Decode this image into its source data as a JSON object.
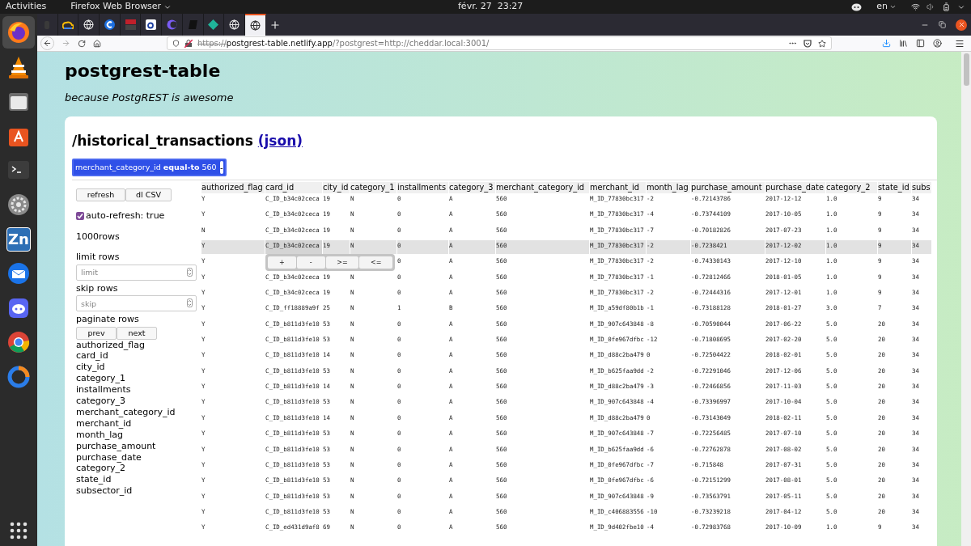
{
  "topbar": {
    "activities": "Activities",
    "app_menu": "Firefox Web Browser",
    "clock": "févr. 27  23:27",
    "language": "en"
  },
  "dock": [
    {
      "kind": "firefox",
      "selected": true
    },
    {
      "kind": "cone",
      "selected": false
    },
    {
      "kind": "folder",
      "selected": false
    },
    {
      "kind": "bag",
      "selected": false
    },
    {
      "kind": "terminal",
      "selected": false
    },
    {
      "kind": "gear",
      "selected": false
    },
    {
      "kind": "zn",
      "label": "Zn",
      "selected": false
    },
    {
      "kind": "mail",
      "selected": false
    },
    {
      "kind": "chat",
      "selected": false
    },
    {
      "kind": "chrome",
      "selected": false
    },
    {
      "kind": "ring",
      "selected": false
    }
  ],
  "browser_tabs": [
    {
      "kind": "dark",
      "selected": false
    },
    {
      "kind": "cloud",
      "selected": false
    },
    {
      "kind": "globe",
      "selected": false
    },
    {
      "kind": "c",
      "selected": false
    },
    {
      "kind": "red",
      "selected": false
    },
    {
      "kind": "square",
      "selected": false
    },
    {
      "kind": "moon",
      "selected": false
    },
    {
      "kind": "note",
      "selected": false
    },
    {
      "kind": "diamond",
      "selected": false
    },
    {
      "kind": "globe",
      "selected": false
    },
    {
      "kind": "globe",
      "selected": true
    }
  ],
  "url": {
    "scheme": "https://",
    "host": "postgrest-table.netlify.app",
    "rest": "/?postgrest=http://cheddar.local:3001/"
  },
  "page": {
    "title": "postgrest-table",
    "subtitle": "because PostgREST is awesome",
    "heading": "/historical_transactions",
    "json_link": "(json)"
  },
  "filter": {
    "column": "merchant_category_id",
    "operator": "equal-to",
    "value": "560",
    "remove": "-"
  },
  "sidebar": {
    "refresh": "refresh",
    "download": "dl CSV",
    "auto_refresh": {
      "label": "auto-refresh: true",
      "checked": true
    },
    "row_count": "1000rows",
    "limit": {
      "label": "limit rows",
      "placeholder": "limit"
    },
    "skip": {
      "label": "skip rows",
      "placeholder": "skip"
    },
    "paginate": {
      "label": "paginate rows",
      "prev": "prev",
      "next": "next"
    },
    "columns": [
      "authorized_flag",
      "card_id",
      "city_id",
      "category_1",
      "installments",
      "category_3",
      "merchant_category_id",
      "merchant_id",
      "month_lag",
      "purchase_amount",
      "purchase_date",
      "category_2",
      "state_id",
      "subsector_id"
    ]
  },
  "table": {
    "columns": [
      "authorized_flag",
      "card_id",
      "city_id",
      "category_1",
      "installments",
      "category_3",
      "merchant_category_id",
      "merchant_id",
      "month_lag",
      "purchase_amount",
      "purchase_date",
      "category_2",
      "state_id",
      "subs"
    ],
    "cell_menu": [
      "+",
      "-",
      ">=",
      "<="
    ],
    "rows": [
      {
        "selected": false,
        "cells": [
          "Y",
          "C_ID_b34c02ceca",
          "19",
          "N",
          "0",
          "A",
          "560",
          "M_ID_77830bc317",
          "-2",
          "-0.72143786",
          "2017-12-12",
          "1.0",
          "9",
          "34"
        ]
      },
      {
        "selected": false,
        "cells": [
          "Y",
          "C_ID_b34c02ceca",
          "19",
          "N",
          "0",
          "A",
          "560",
          "M_ID_77830bc317",
          "-4",
          "-0.73744109",
          "2017-10-05",
          "1.0",
          "9",
          "34"
        ]
      },
      {
        "selected": false,
        "cells": [
          "N",
          "C_ID_b34c02ceca",
          "19",
          "N",
          "0",
          "A",
          "560",
          "M_ID_77830bc317",
          "-7",
          "-0.70182826",
          "2017-07-23",
          "1.0",
          "9",
          "34"
        ]
      },
      {
        "selected": true,
        "cells": [
          "Y",
          "C_ID_b34c02ceca",
          "19",
          "N",
          "0",
          "A",
          "560",
          "M_ID_77830bc317",
          "-2",
          "-0.7238421",
          "2017-12-02",
          "1.0",
          "9",
          "34"
        ]
      },
      {
        "selected": false,
        "cells": [
          "Y",
          null,
          null,
          null,
          "0",
          "A",
          "560",
          "M_ID_77830bc317",
          "-2",
          "-0.74330143",
          "2017-12-10",
          "1.0",
          "9",
          "34"
        ]
      },
      {
        "selected": false,
        "cells": [
          "Y",
          "C_ID_b34c02ceca",
          "19",
          "N",
          "0",
          "A",
          "560",
          "M_ID_77830bc317",
          "-1",
          "-0.72812466",
          "2018-01-05",
          "1.0",
          "9",
          "34"
        ]
      },
      {
        "selected": false,
        "cells": [
          "Y",
          "C_ID_b34c02ceca",
          "19",
          "N",
          "0",
          "A",
          "560",
          "M_ID_77830bc317",
          "-2",
          "-0.72444316",
          "2017-12-01",
          "1.0",
          "9",
          "34"
        ]
      },
      {
        "selected": false,
        "cells": [
          "Y",
          "C_ID_ff18889a9f",
          "25",
          "N",
          "1",
          "B",
          "560",
          "M_ID_a59df80b1b",
          "-1",
          "-0.73188128",
          "2018-01-27",
          "3.0",
          "7",
          "34"
        ]
      },
      {
        "selected": false,
        "cells": [
          "Y",
          "C_ID_b811d3fe10",
          "53",
          "N",
          "0",
          "A",
          "560",
          "M_ID_907c643848",
          "-8",
          "-0.70590044",
          "2017-06-22",
          "5.0",
          "20",
          "34"
        ]
      },
      {
        "selected": false,
        "cells": [
          "Y",
          "C_ID_b811d3fe10",
          "53",
          "N",
          "0",
          "A",
          "560",
          "M_ID_0fe967dfbc",
          "-12",
          "-0.71808695",
          "2017-02-20",
          "5.0",
          "20",
          "34"
        ]
      },
      {
        "selected": false,
        "cells": [
          "Y",
          "C_ID_b811d3fe10",
          "14",
          "N",
          "0",
          "A",
          "560",
          "M_ID_d88c2ba479",
          "0",
          "-0.72504422",
          "2018-02-01",
          "5.0",
          "20",
          "34"
        ]
      },
      {
        "selected": false,
        "cells": [
          "Y",
          "C_ID_b811d3fe10",
          "53",
          "N",
          "0",
          "A",
          "560",
          "M_ID_b625faa9dd",
          "-2",
          "-0.72291046",
          "2017-12-06",
          "5.0",
          "20",
          "34"
        ]
      },
      {
        "selected": false,
        "cells": [
          "Y",
          "C_ID_b811d3fe10",
          "14",
          "N",
          "0",
          "A",
          "560",
          "M_ID_d88c2ba479",
          "-3",
          "-0.72466856",
          "2017-11-03",
          "5.0",
          "20",
          "34"
        ]
      },
      {
        "selected": false,
        "cells": [
          "Y",
          "C_ID_b811d3fe10",
          "53",
          "N",
          "0",
          "A",
          "560",
          "M_ID_907c643848",
          "-4",
          "-0.73396997",
          "2017-10-04",
          "5.0",
          "20",
          "34"
        ]
      },
      {
        "selected": false,
        "cells": [
          "Y",
          "C_ID_b811d3fe10",
          "14",
          "N",
          "0",
          "A",
          "560",
          "M_ID_d88c2ba479",
          "0",
          "-0.73143049",
          "2018-02-11",
          "5.0",
          "20",
          "34"
        ]
      },
      {
        "selected": false,
        "cells": [
          "Y",
          "C_ID_b811d3fe10",
          "53",
          "N",
          "0",
          "A",
          "560",
          "M_ID_907c643848",
          "-7",
          "-0.72256485",
          "2017-07-10",
          "5.0",
          "20",
          "34"
        ]
      },
      {
        "selected": false,
        "cells": [
          "Y",
          "C_ID_b811d3fe10",
          "53",
          "N",
          "0",
          "A",
          "560",
          "M_ID_b625faa9dd",
          "-6",
          "-0.72762878",
          "2017-08-02",
          "5.0",
          "20",
          "34"
        ]
      },
      {
        "selected": false,
        "cells": [
          "Y",
          "C_ID_b811d3fe10",
          "53",
          "N",
          "0",
          "A",
          "560",
          "M_ID_0fe967dfbc",
          "-7",
          "-0.715848",
          "2017-07-31",
          "5.0",
          "20",
          "34"
        ]
      },
      {
        "selected": false,
        "cells": [
          "Y",
          "C_ID_b811d3fe10",
          "53",
          "N",
          "0",
          "A",
          "560",
          "M_ID_0fe967dfbc",
          "-6",
          "-0.72151299",
          "2017-08-01",
          "5.0",
          "20",
          "34"
        ]
      },
      {
        "selected": false,
        "cells": [
          "Y",
          "C_ID_b811d3fe10",
          "53",
          "N",
          "0",
          "A",
          "560",
          "M_ID_907c643848",
          "-9",
          "-0.73563791",
          "2017-05-11",
          "5.0",
          "20",
          "34"
        ]
      },
      {
        "selected": false,
        "cells": [
          "Y",
          "C_ID_b811d3fe10",
          "53",
          "N",
          "0",
          "A",
          "560",
          "M_ID_c406883556",
          "-10",
          "-0.73239218",
          "2017-04-12",
          "5.0",
          "20",
          "34"
        ]
      },
      {
        "selected": false,
        "cells": [
          "Y",
          "C_ID_ed431d9af8",
          "69",
          "N",
          "0",
          "A",
          "560",
          "M_ID_9d402fbe10",
          "-4",
          "-0.72983768",
          "2017-10-09",
          "1.0",
          "9",
          "34"
        ]
      }
    ]
  }
}
